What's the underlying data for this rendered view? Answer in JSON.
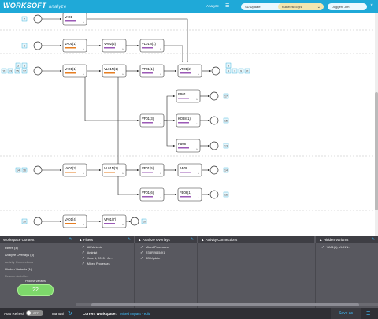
{
  "topbar": {
    "logo": "WORKSOFT",
    "logo_sub": "analyze",
    "analyze_label": "Analyze",
    "dropdown1": "SD Update",
    "dropdown2": "R3BR2645@1",
    "user": "Doggen, Jim",
    "close": "✕"
  },
  "colors": {
    "accent": "#1fa9d8",
    "panel": "#58585f",
    "green": "#7dd86b",
    "node_border": "#333333",
    "edge": "#222222"
  },
  "graph": {
    "rows": [
      {
        "count_badges": [
          "7"
        ],
        "nodes": [
          {
            "label": "VA01",
            "sub": "VA01 | 1/1/11 ...",
            "bar": "#9b59b6"
          }
        ],
        "end_badges": []
      },
      {
        "count_badges": [
          "6"
        ],
        "nodes": [
          {
            "label": "VA01(1)",
            "sub": "",
            "bar": "#e67e22"
          },
          {
            "label": "VA02(2)",
            "sub": "",
            "bar": "#9b59b6"
          },
          {
            "label": "VL01N(1)",
            "sub": "",
            "bar": "#9b59b6"
          }
        ],
        "end_badges": []
      },
      {
        "count_badges": [
          "3",
          "5",
          "11",
          "13",
          "15",
          "17"
        ],
        "nodes": [
          {
            "label": "VA01(1)",
            "sub": "",
            "bar": "#e67e22"
          },
          {
            "label": "VL01N(1)",
            "sub": "",
            "bar": "#e67e22"
          },
          {
            "label": "VF01(1)",
            "sub": "",
            "bar": "#9b59b6"
          },
          {
            "label": "VF01(2)",
            "sub": "",
            "bar": "#9b59b6"
          }
        ],
        "end_badges": [
          "3",
          "5",
          "7",
          "9",
          "11"
        ]
      },
      {
        "nodes": [
          {
            "label": "FB01",
            "sub": "",
            "bar": "#9b59b6"
          }
        ],
        "end_badges": [
          "17"
        ]
      },
      {
        "nodes": [
          {
            "label": "VF01(3)",
            "sub": "",
            "bar": "#9b59b6"
          },
          {
            "label": "KO88(1)",
            "sub": "",
            "bar": "#9b59b6"
          }
        ],
        "end_badges": [
          "15"
        ]
      },
      {
        "nodes": [
          {
            "label": "FB08",
            "sub": "",
            "bar": "#9b59b6"
          }
        ],
        "end_badges": [
          "13"
        ]
      },
      {
        "count_badges": [
          "14",
          "16"
        ],
        "nodes": [
          {
            "label": "VA01(3)",
            "sub": "",
            "bar": "#e67e22"
          },
          {
            "label": "VL01N(2)",
            "sub": "",
            "bar": "#e67e22"
          },
          {
            "label": "VF01(5)",
            "sub": "",
            "bar": "#9b59b6"
          },
          {
            "label": "AB08",
            "sub": "",
            "bar": "#9b59b6"
          }
        ],
        "end_badges": [
          "14"
        ]
      },
      {
        "nodes": [
          {
            "label": "VF01(6)",
            "sub": "",
            "bar": "#9b59b6"
          },
          {
            "label": "FB08(1)",
            "sub": "",
            "bar": "#9b59b6"
          }
        ],
        "end_badges": [
          "16"
        ]
      },
      {
        "count_badges": [
          "10"
        ],
        "nodes": [
          {
            "label": "VA01(4)",
            "sub": "",
            "bar": "#e67e22"
          },
          {
            "label": "VF01(7)",
            "sub": "",
            "bar": "#9b59b6"
          }
        ],
        "end_badges": [
          "10"
        ]
      }
    ]
  },
  "workspace": {
    "header": "Workspace Content",
    "items": [
      "Filters (4)",
      "Analyze Overlays (3)",
      "Activity Connections",
      "Hidden Variants (1)",
      "Rescue Activities"
    ],
    "process_variants_label": "Process variants",
    "process_variants_value": "22"
  },
  "filters": {
    "header": "Filters",
    "items": [
      "All Variants",
      "Aminist",
      "June 1, 2015 - Ju...",
      "Mixed Processes"
    ]
  },
  "overlays": {
    "header": "Analyze Overlays",
    "items": [
      "Mixed Processes",
      "R3BR2645@1",
      "SD Update"
    ]
  },
  "connections": {
    "header": "Activity Connections"
  },
  "hidden": {
    "header": "Hidden Variants",
    "items": [
      "VA01(1), VL01N..."
    ]
  },
  "bottombar": {
    "auto_refresh": "Auto Refresh",
    "toggle": "OFF",
    "manual": "Manual",
    "current_ws_label": "Current Workspace:",
    "current_ws_value": "Mixed Impact - edit",
    "save_as": "Save as"
  }
}
